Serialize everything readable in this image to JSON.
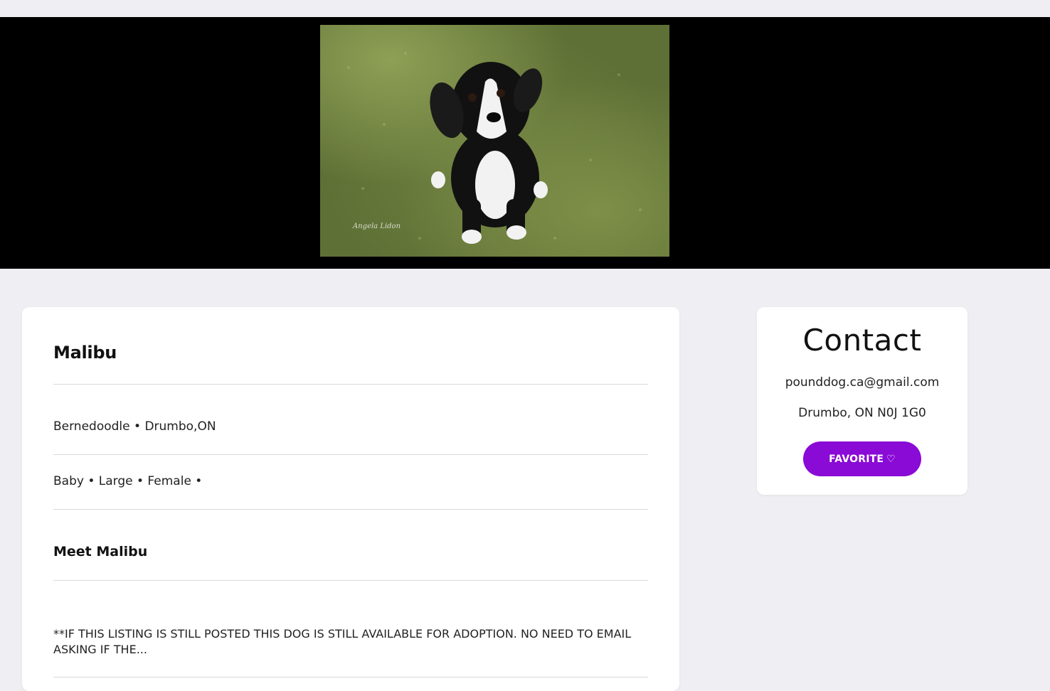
{
  "pet": {
    "name": "Malibu",
    "breed_location": "Bernedoodle • Drumbo,ON",
    "attributes": "Baby • Large • Female •",
    "meet_heading": "Meet Malibu",
    "description": "**IF THIS LISTING IS STILL POSTED THIS DOG IS STILL AVAILABLE FOR ADOPTION. NO NEED TO EMAIL ASKING IF THE..."
  },
  "contact": {
    "title": "Contact",
    "email": "pounddog.ca@gmail.com",
    "location": "Drumbo, ON N0J 1G0",
    "favorite_label": "FAVORITE",
    "favorite_icon": "♡"
  },
  "colors": {
    "accent": "#8a0ad6",
    "page_background": "#efeef3",
    "hero_background": "#000000"
  },
  "icons": [
    "heart-outline-icon"
  ]
}
